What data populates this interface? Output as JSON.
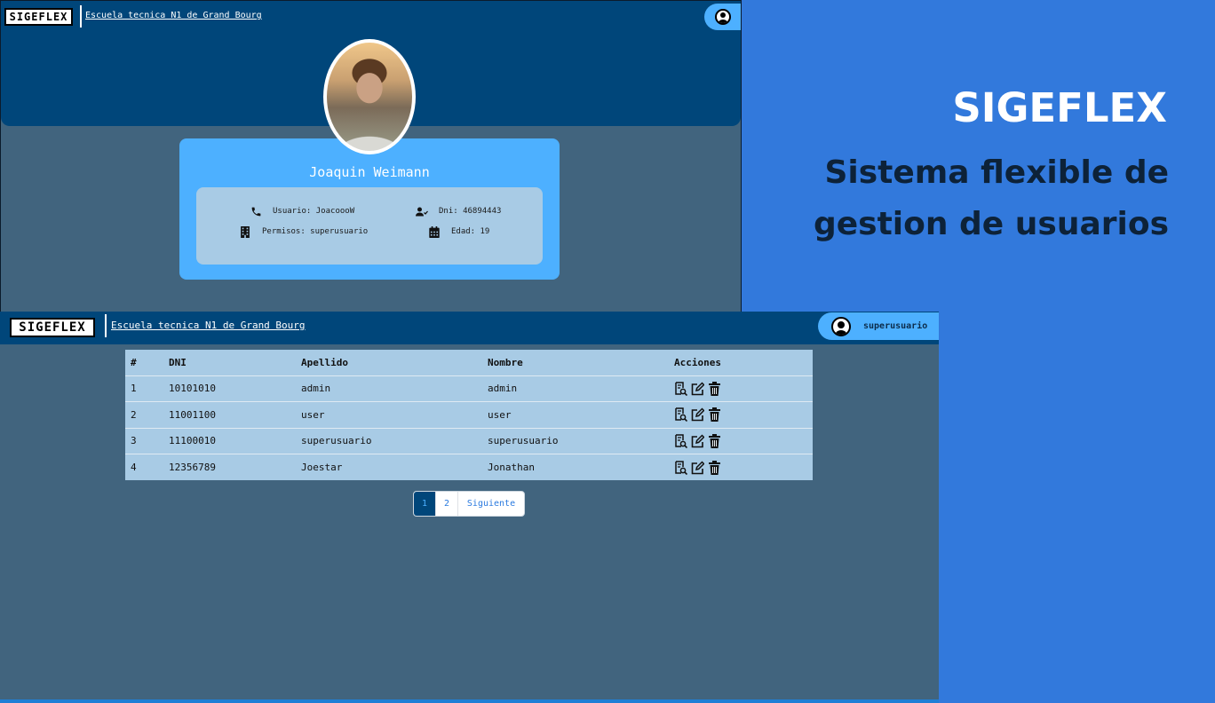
{
  "profile_screen": {
    "brand": "SIGEFLEX",
    "school": "Escuela tecnica N1 de Grand Bourg",
    "user_icon": "user-circle-icon",
    "name": "Joaquin Weimann",
    "fields": {
      "usuario": "Usuario: JoacoooW",
      "dni": "Dni: 46894443",
      "permisos": "Permisos: superusuario",
      "edad": "Edad: 19"
    }
  },
  "table_screen": {
    "brand": "SIGEFLEX",
    "school": "Escuela tecnica N1 de Grand Bourg",
    "username": "superusuario",
    "columns": [
      "#",
      "DNI",
      "Apellido",
      "Nombre",
      "Acciones"
    ],
    "rows": [
      {
        "n": "1",
        "dni": "10101010",
        "apellido": "admin",
        "nombre": "admin"
      },
      {
        "n": "2",
        "dni": "11001100",
        "apellido": "user",
        "nombre": "user"
      },
      {
        "n": "3",
        "dni": "11100010",
        "apellido": "superusuario",
        "nombre": "superusuario"
      },
      {
        "n": "4",
        "dni": "12356789",
        "apellido": "Joestar",
        "nombre": "Jonathan"
      }
    ],
    "pagination": {
      "page1": "1",
      "page2": "2",
      "next": "Siguiente"
    }
  },
  "promo": {
    "title": "SIGEFLEX",
    "subtitle": "Sistema flexible de gestion de usuarios"
  },
  "colors": {
    "page_bg": "#3279dc",
    "header": "#00467a",
    "panel_bg": "#41647e",
    "accent": "#4db0ff",
    "table_bg": "#a8cbe5"
  }
}
